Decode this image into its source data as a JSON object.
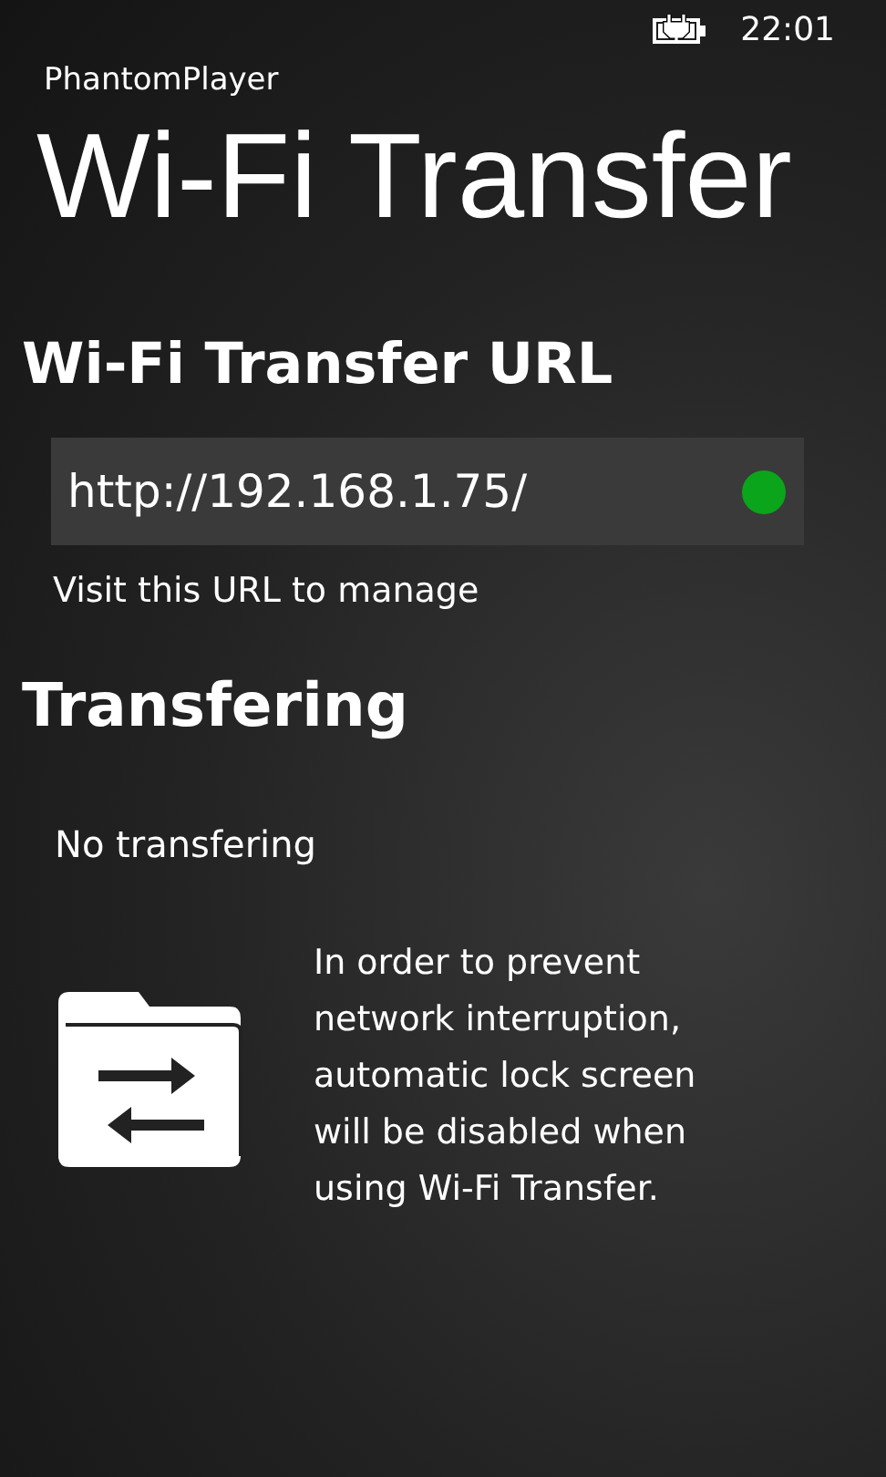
{
  "status_bar": {
    "time": "22:01",
    "charging": true
  },
  "app_name": "PhantomPlayer",
  "page_title": "Wi-Fi Transfer",
  "url_section": {
    "heading": "Wi-Fi Transfer URL",
    "url": "http://192.168.1.75/",
    "server_running": true,
    "caption": "Visit this URL to manage"
  },
  "transfer_section": {
    "heading": "Transfering",
    "status": "No transfering"
  },
  "notice": "In order to prevent network interruption, automatic lock screen will be disabled when using Wi-Fi Transfer."
}
